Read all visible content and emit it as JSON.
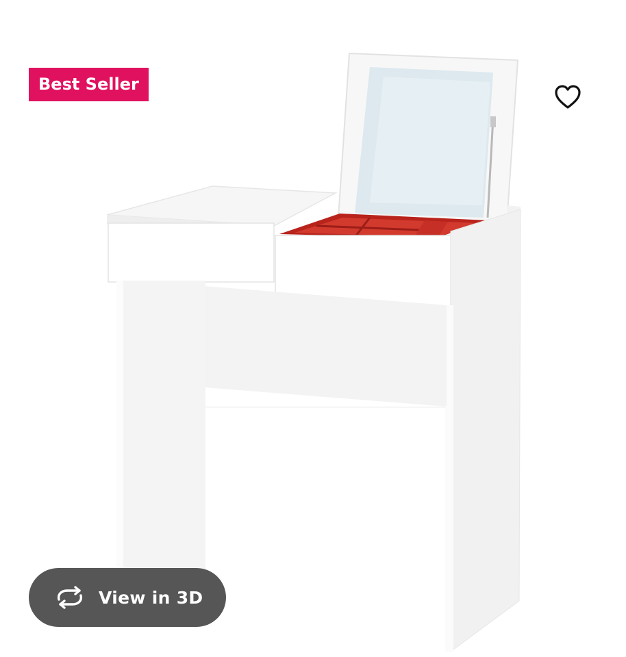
{
  "badge": {
    "label": "Best Seller",
    "color": "#e0115f"
  },
  "favorite": {
    "icon": "heart-outline-icon"
  },
  "product": {
    "image_icon": "dressing-table-illustration",
    "accent_color": "#c62a20"
  },
  "view_3d": {
    "label": "View in 3D",
    "icon": "rotate-arrows-icon"
  }
}
